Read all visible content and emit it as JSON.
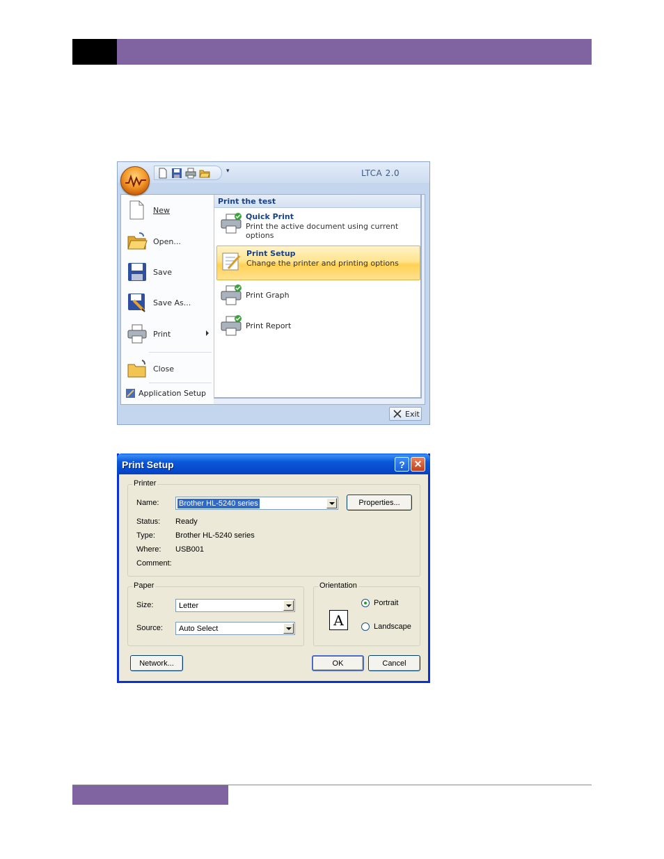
{
  "office_menu": {
    "app_title": "LTCA 2.0",
    "quick_access": [
      "new-doc-icon",
      "save-icon",
      "print-icon",
      "open-folder-icon"
    ],
    "left_items": [
      {
        "label": "New",
        "icon": "new-document-icon"
      },
      {
        "label": "Open...",
        "icon": "open-folder-icon"
      },
      {
        "label": "Save",
        "icon": "save-disk-icon"
      },
      {
        "label": "Save As...",
        "icon": "save-as-icon"
      },
      {
        "label": "Print",
        "icon": "printer-icon"
      },
      {
        "label": "Close",
        "icon": "close-folder-icon"
      }
    ],
    "application_setup": "Application Setup",
    "panel_header": "Print the test",
    "right_items": [
      {
        "title": "Quick Print",
        "desc": "Print the active document using current options"
      },
      {
        "title": "Print Setup",
        "desc": "Change the printer and printing options"
      },
      {
        "title": "Print Graph",
        "desc": ""
      },
      {
        "title": "Print Report",
        "desc": ""
      }
    ],
    "exit_label": "Exit"
  },
  "print_setup": {
    "title": "Print Setup",
    "help_glyph": "?",
    "close_glyph": "✕",
    "printer_group": "Printer",
    "name_label": "Name:",
    "name_value": "Brother HL-5240 series",
    "properties_label": "Properties...",
    "status_label": "Status:",
    "status_value": "Ready",
    "type_label": "Type:",
    "type_value": "Brother HL-5240 series",
    "where_label": "Where:",
    "where_value": "USB001",
    "comment_label": "Comment:",
    "comment_value": "",
    "paper_group": "Paper",
    "size_label": "Size:",
    "size_value": "Letter",
    "source_label": "Source:",
    "source_value": "Auto Select",
    "orientation_group": "Orientation",
    "orientation_glyph": "A",
    "portrait_label": "Portrait",
    "landscape_label": "Landscape",
    "orientation_selected": "Portrait",
    "network_label": "Network...",
    "ok_label": "OK",
    "cancel_label": "Cancel"
  }
}
